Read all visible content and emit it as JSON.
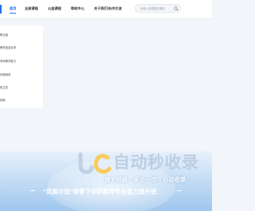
{
  "nav": {
    "items": [
      {
        "label": "首页",
        "active": true
      },
      {
        "label": "全部课程",
        "active": false
      },
      {
        "label": "公益课程",
        "active": false
      },
      {
        "label": "帮助中心",
        "active": false
      },
      {
        "label": "关于我们/合作交流",
        "active": false
      }
    ]
  },
  "search": {
    "placeholder": "请输入您想要的课程",
    "icon": "search-icon"
  },
  "sidebar": {
    "items": [
      {
        "label": "职业能",
        "icon": "chevron-right-icon"
      },
      {
        "label": "教育信息化学",
        "icon": "chevron-right-icon"
      },
      {
        "label": "学科教学能力",
        "icon": "chevron-right-icon"
      },
      {
        "label": "师德师风",
        "icon": "chevron-right-icon"
      },
      {
        "label": "班主任",
        "icon": "chevron-right-icon"
      },
      {
        "label": "其他",
        "icon": "chevron-right-icon"
      }
    ]
  },
  "banner": {
    "headline": "“双高计划”背景下中职教师专业能力提升班",
    "watermark_title": "自动秒收录",
    "watermark_tagline": "做上线搓→来访一次→自动收录"
  },
  "colors": {
    "accent": "#1e6fe6",
    "banner_top": "#e8f1fb",
    "banner_bottom": "#9fc6ee"
  }
}
